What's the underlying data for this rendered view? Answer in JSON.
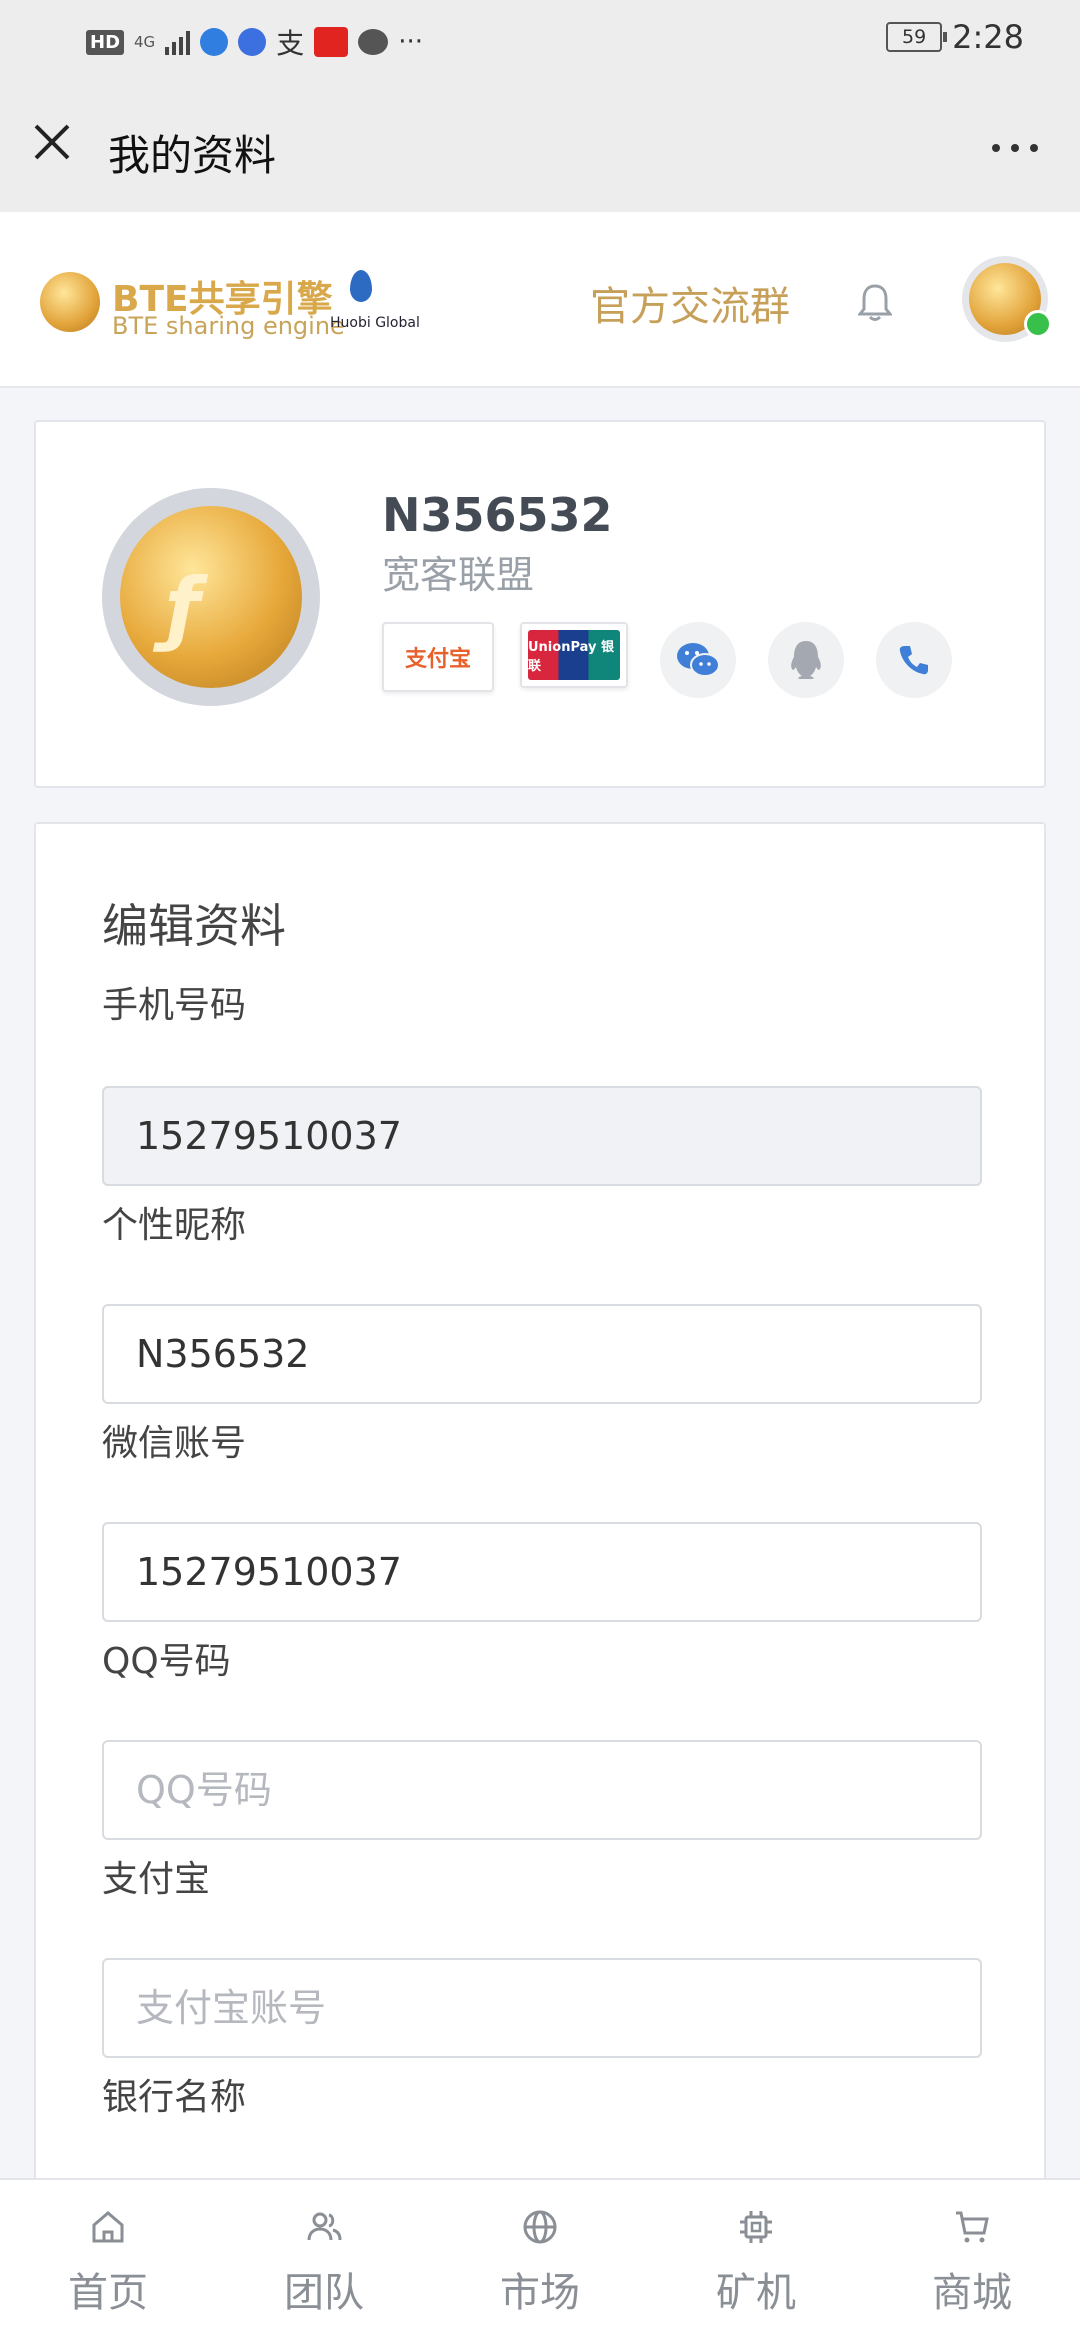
{
  "status_bar": {
    "network": "4G",
    "battery": "59",
    "time": "2:28"
  },
  "titlebar": {
    "title": "我的资料"
  },
  "header": {
    "logo_title": "BTE共享引擎",
    "logo_subtitle": "BTE sharing engine",
    "partner": "Huobi Global",
    "group_link": "官方交流群"
  },
  "profile": {
    "username": "N356532",
    "team": "宽客联盟",
    "alipay_label": "支付宝",
    "unionpay_label": "UnionPay 银联"
  },
  "edit": {
    "title": "编辑资料",
    "phone_label": "手机号码",
    "phone_value": "15279510037",
    "nickname_label": "个性昵称",
    "nickname_value": "N356532",
    "wechat_label": "微信账号",
    "wechat_value": "15279510037",
    "qq_label": "QQ号码",
    "qq_placeholder": "QQ号码",
    "alipay_label": "支付宝",
    "alipay_placeholder": "支付宝账号",
    "bank_label": "银行名称"
  },
  "tabs": [
    {
      "label": "首页",
      "icon": "home-icon"
    },
    {
      "label": "团队",
      "icon": "team-icon"
    },
    {
      "label": "市场",
      "icon": "globe-icon"
    },
    {
      "label": "矿机",
      "icon": "chip-icon"
    },
    {
      "label": "商城",
      "icon": "cart-icon"
    }
  ],
  "colors": {
    "gold": "#c6a059",
    "online": "#37c04a",
    "icon_blue": "#3f7fd8"
  }
}
